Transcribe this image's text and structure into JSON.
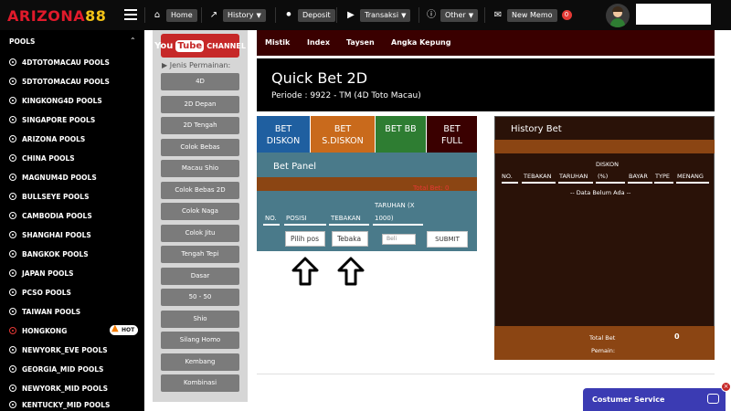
{
  "brand": {
    "logo_part1": "ARIZONA",
    "logo_part2": "88"
  },
  "topnav": {
    "home": "Home",
    "history": "History",
    "deposit": "Deposit",
    "transaksi": "Transaksi",
    "other": "Other",
    "new_memo": "New Memo",
    "memo_count": "0"
  },
  "sidebar": {
    "header": "POOLS",
    "items": [
      "4DTOTOMACAU POOLS",
      "5DTOTOMACAU POOLS",
      "KINGKONG4D POOLS",
      "SINGAPORE POOLS",
      "ARIZONA POOLS",
      "CHINA POOLS",
      "MAGNUM4D POOLS",
      "BULLSEYE POOLS",
      "CAMBODIA POOLS",
      "SHANGHAI POOLS",
      "BANGKOK POOLS",
      "JAPAN POOLS",
      "PCSO POOLS",
      "TAIWAN POOLS",
      "HONGKONG",
      "NEWYORK_EVE POOLS",
      "GEORGIA_MID POOLS",
      "NEWYORK_MID POOLS",
      "KENTUCKY_MID POOLS"
    ],
    "hot_badge": "HOT"
  },
  "game_menu": {
    "youtube_you": "You",
    "youtube_tube": "Tube",
    "youtube_channel": "CHANNEL",
    "jenis_label": "Jenis Permainan:",
    "buttons": [
      "4D",
      "2D Depan",
      "2D Tengah",
      "Colok Bebas",
      "Macau Shio",
      "Colok Bebas 2D",
      "Colok Naga",
      "Colok Jitu",
      "Tengah Tepi",
      "Dasar",
      "50 - 50",
      "Shio",
      "Silang Homo",
      "Kembang",
      "Kombinasi"
    ]
  },
  "subnav": {
    "items": [
      "Mistik",
      "Index",
      "Taysen",
      "Angka Kepung"
    ]
  },
  "quickbet": {
    "title": "Quick Bet 2D",
    "periode": "Periode : 9922 - TM (4D Toto Macau)"
  },
  "tabs": [
    {
      "line1": "BET",
      "line2": "DISKON",
      "color": "#1f5fa0"
    },
    {
      "line1": "BET",
      "line2": "S.DISKON",
      "color": "#c96a1c"
    },
    {
      "line1": "BET BB",
      "line2": "",
      "color": "#2e7d32"
    },
    {
      "line1": "BET",
      "line2": "FULL",
      "color": "#3a0000"
    }
  ],
  "bet_panel": {
    "title": "Bet Panel",
    "total_bet": "Total Bet: 0",
    "headers": {
      "no": "NO.",
      "posisi": "POSISI",
      "tebakan": "TEBAKAN",
      "taruhan_1": "TARUHAN (X",
      "taruhan_2": "1000)"
    },
    "posisi_value": "Pilih pos",
    "tebakan_value": "Tebaka",
    "beli_placeholder": "Beli",
    "submit": "SUBMIT"
  },
  "history": {
    "title": "History Bet",
    "headers": {
      "no": "NO.",
      "tebakan": "TEBAKAN",
      "taruhan": "TARUHAN",
      "diskon": "DISKON",
      "diskon_pct": "(%)",
      "bayar": "BAYAR",
      "type": "TYPE",
      "menang": "MENANG"
    },
    "empty": "-- Data Belum Ada --",
    "total_bet_label": "Total Bet",
    "total_bet_value": "0",
    "pemain_label": "Pemain:"
  },
  "customer_service": {
    "label": "Costumer Service"
  },
  "colors": {
    "topbar": "#0c0c0c",
    "accent_red": "#e11a2b",
    "history_bg": "#2a1208",
    "strip_brown": "#8b4513",
    "panel_teal": "#4a7a8a"
  }
}
